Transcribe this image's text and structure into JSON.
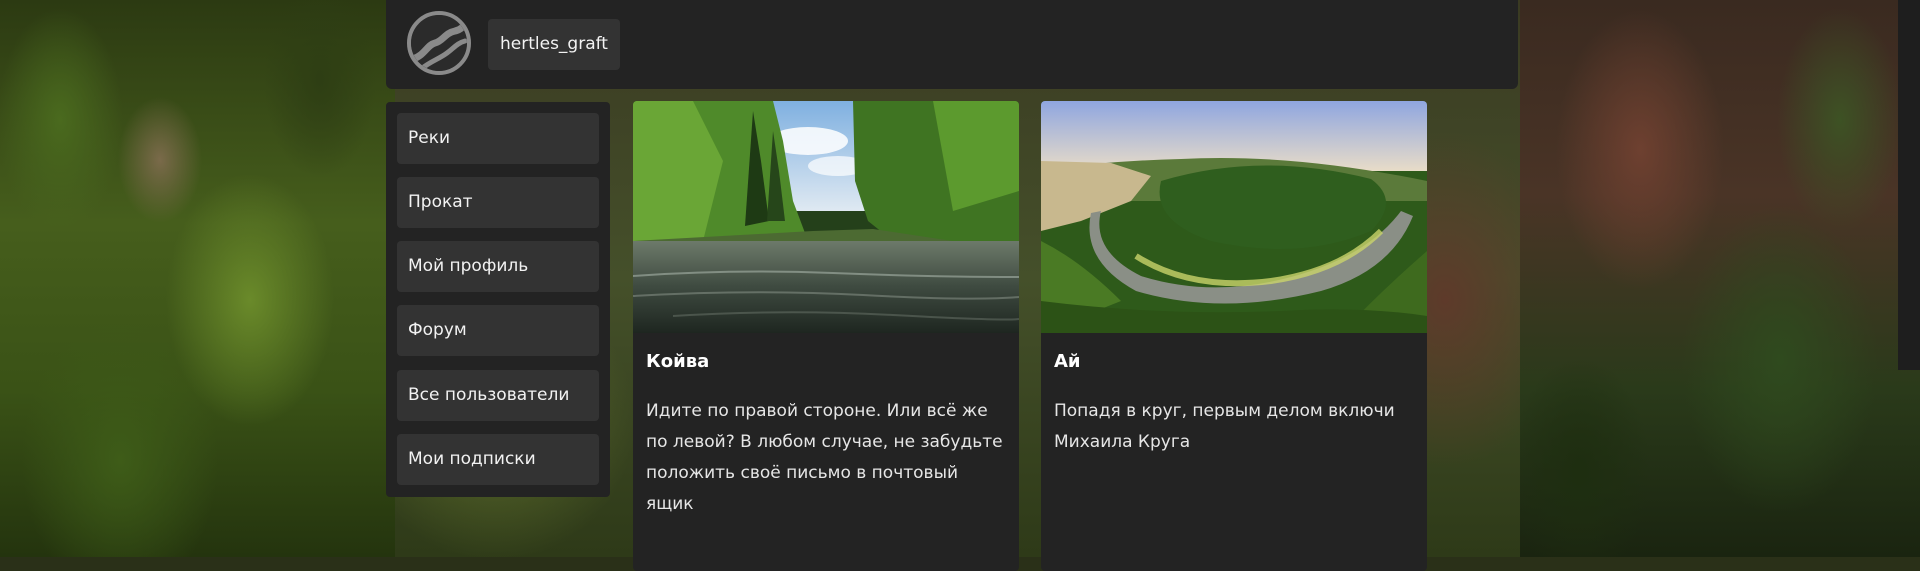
{
  "header": {
    "username": "hertles_graft"
  },
  "sidebar": {
    "items": [
      {
        "label": "Реки"
      },
      {
        "label": "Прокат"
      },
      {
        "label": "Мой профиль"
      },
      {
        "label": "Форум"
      },
      {
        "label": "Все пользователи"
      },
      {
        "label": "Мои подписки"
      }
    ]
  },
  "cards": [
    {
      "title": "Койва",
      "text": "Идите по правой стороне. Или всё же по левой? В любом случае, не забудьте положить своё письмо в почтовый ящик"
    },
    {
      "title": "Ай",
      "text": "Попадя в круг, первым делом включи Михаила Круга"
    }
  ],
  "colors": {
    "panel": "#232323",
    "button": "#333333",
    "text": "#f2f2f2"
  }
}
